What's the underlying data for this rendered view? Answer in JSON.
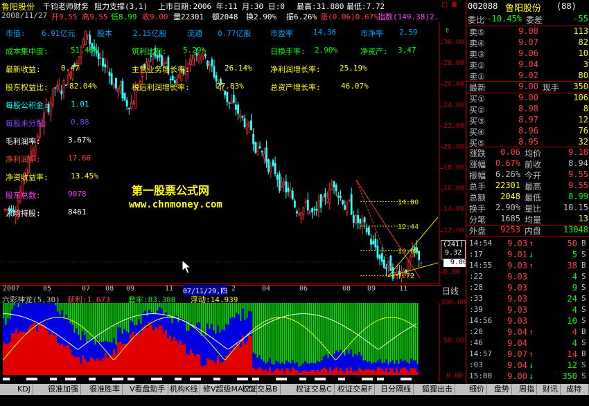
{
  "header": {
    "stock_name": "鲁阳股份",
    "indicator_title": "千钧老师财务",
    "indicator2": "阻力支撑(3,1)",
    "listing_label": "上市日期:2006 年:11 月:30 日:0",
    "high_label": "最高:31.880",
    "low_label": "最低:7.72",
    "date": "2008/11/27",
    "open": "开9.55",
    "high": "高9.55",
    "low": "低8.99",
    "close": "收9.00",
    "volume": "量22301",
    "amount": "额2048",
    "turnover": "换2.90%",
    "amplitude": "振6.26%",
    "change": "涨(0.06)0.67%",
    "index": "指数(149.38)2."
  },
  "fundamentals": [
    {
      "label": "市值:",
      "value": "6.91亿元",
      "color": "#00a0ff"
    },
    {
      "label": "股本",
      "value": "2.15亿股",
      "color": "#00a0ff"
    },
    {
      "label": "流通",
      "value": "0.77亿股",
      "color": "#00a0ff"
    },
    {
      "label": "市盈率",
      "value": "14.36",
      "color": "#00a0ff"
    },
    {
      "label": "市净率",
      "value": "2.59",
      "color": "#00a0ff"
    },
    {
      "label": "成本集中度:",
      "value": "51.48%",
      "color": "#00ff00"
    },
    {
      "label": "筑利比例:",
      "value": "5.29%",
      "color": "#00ff00"
    },
    {
      "label": "日换手率:",
      "value": "2.90%",
      "color": "#00ff00"
    },
    {
      "label": "净资产:",
      "value": "3.47",
      "color": "#00ff00"
    },
    {
      "label": "最新收益:",
      "value": "0.47",
      "color": "#ffff00"
    },
    {
      "label": "主营业务增长率:",
      "value": "26.14%",
      "color": "#ffff00"
    },
    {
      "label": "净利润增长率:",
      "value": "25.19%",
      "color": "#ffff00"
    },
    {
      "label": "股东权益比:",
      "value": "82.04%",
      "color": "#ffff00"
    },
    {
      "label": "税后利润增长率:",
      "value": "27.83%",
      "color": "#ffff00"
    },
    {
      "label": "总资产增长率:",
      "value": "46.07%",
      "color": "#ffff00"
    },
    {
      "label": "每股公积金:",
      "value": "1.01",
      "color": "#00ffff"
    },
    {
      "label": "每股未分配:",
      "value": "0.88",
      "color": "#8040ff"
    },
    {
      "label": "毛利润率:",
      "value": "3.67%",
      "color": "#ffffff"
    },
    {
      "label": "净利润率:",
      "value": "17.66",
      "color": "#ff4040"
    },
    {
      "label": "净资收益率:",
      "value": "13.45%",
      "color": "#ffff00"
    },
    {
      "label": "股东总数:",
      "value": "9078",
      "color": "#ff40ff"
    },
    {
      "label": "人均持股:",
      "value": "8461",
      "color": "#ffffff"
    }
  ],
  "watermark": {
    "line1": "第一股票公式网",
    "line2": "www.chnmoney.com"
  },
  "price_axis": [
    "30.00",
    "28.00",
    "26.00",
    "24.00",
    "22.00",
    "20.00",
    "18.00",
    "16.00",
    "14.00",
    "12.00",
    "10.00",
    "8.00"
  ],
  "levels": [
    "14.80",
    "12.44",
    "10.08",
    "7.72"
  ],
  "cursor_price": "9.00",
  "cursor_box": {
    "line1": "(241)",
    "line2": "9.32"
  },
  "time_axis": [
    "2007",
    "05",
    "07",
    "08",
    "09",
    "11",
    "07/11/29,四",
    "2",
    "04",
    "06",
    "08",
    "09",
    "11"
  ],
  "period_label": "日线",
  "sub_indicator": {
    "name": "六彩神龙(5,30)",
    "v1": "获利:1.673",
    "v2": "套牢:83.388",
    "v3": "浮动:14.939",
    "axis": [
      "100.00",
      "50.00",
      "0.00"
    ]
  },
  "quote": {
    "code": "002088",
    "name": "鲁阳股份",
    "suffix": "(88)",
    "wei_bi_label": "委比",
    "wei_bi": "-10.45%",
    "wei_cha_label": "委差",
    "wei_cha": "-55",
    "sells": [
      {
        "label": "卖⑤",
        "price": "9.08",
        "vol": "113"
      },
      {
        "label": "卖④",
        "price": "9.07",
        "vol": "82"
      },
      {
        "label": "卖③",
        "price": "9.06",
        "vol": "10"
      },
      {
        "label": "卖②",
        "price": "9.04",
        "vol": "3"
      },
      {
        "label": "卖①",
        "price": "9.02",
        "vol": "80"
      }
    ],
    "latest_label": "最新",
    "latest": "9.00",
    "cur_hand_label": "现手",
    "cur_hand": "350",
    "buys": [
      {
        "label": "买①",
        "price": "9.00",
        "vol": "106"
      },
      {
        "label": "买②",
        "price": "8.98",
        "vol": "8"
      },
      {
        "label": "买③",
        "price": "8.97",
        "vol": "12"
      },
      {
        "label": "买④",
        "price": "8.96",
        "vol": "76"
      },
      {
        "label": "买⑤",
        "price": "8.95",
        "vol": "32"
      }
    ],
    "stats": [
      {
        "l1": "涨跌",
        "v1": "0.06",
        "l2": "均价",
        "v2": "9.18"
      },
      {
        "l1": "涨幅",
        "v1": "0.67%",
        "l2": "前收",
        "v2": "8.94"
      },
      {
        "l1": "振幅",
        "v1": "6.26%",
        "l2": "今开",
        "v2": "9.55"
      },
      {
        "l1": "总手",
        "v1": "22301",
        "l2": "最高",
        "v2": "9.55"
      },
      {
        "l1": "总额",
        "v1": "2048",
        "l2": "最低",
        "v2": "8.99"
      },
      {
        "l1": "换手",
        "v1": "2.90%",
        "l2": "量比",
        "v2": "10.15"
      },
      {
        "l1": "分笔",
        "v1": "1685",
        "l2": "均量",
        "v2": "13"
      }
    ],
    "outer_label": "外盘",
    "outer": "9253",
    "inner_label": "内盘",
    "inner": "13048",
    "ticks": [
      {
        "t": "14:54",
        "p": "9.03",
        "a": "↑",
        "v": "50",
        "s": "B"
      },
      {
        "t": ":17",
        "p": "9.01",
        "a": "↓",
        "v": "5",
        "s": "S"
      },
      {
        "t": "14:55",
        "p": "9.03",
        "a": "↑",
        "v": "38",
        "s": "B"
      },
      {
        "t": ":22",
        "p": "9.03",
        "a": "",
        "v": "4",
        "s": "S"
      },
      {
        "t": ":28",
        "p": "9.03",
        "a": "",
        "v": "9",
        "s": "S"
      },
      {
        "t": ":33",
        "p": "9.03",
        "a": "",
        "v": "24",
        "s": "S"
      },
      {
        "t": ":39",
        "p": "9.03",
        "a": "",
        "v": "4",
        "s": "S"
      },
      {
        "t": "14:56",
        "p": "9.03",
        "a": "",
        "v": "10",
        "s": "S"
      },
      {
        "t": ":20",
        "p": "9.04",
        "a": "↑",
        "v": "4",
        "s": "B"
      },
      {
        "t": ":46",
        "p": "9.04",
        "a": "",
        "v": "4",
        "s": "S"
      },
      {
        "t": "14:57",
        "p": "9.07",
        "a": "↑",
        "v": "14",
        "s": "B"
      },
      {
        "t": ":03",
        "p": "9.04",
        "a": "↓",
        "v": "12",
        "s": "S"
      },
      {
        "t": "15:00",
        "p": "9.00",
        "a": "↓",
        "v": "350",
        "s": "S"
      }
    ]
  },
  "tabs": [
    "KDJ",
    "很准加强",
    "很准胜率",
    "V看盘助手",
    "机构K线",
    "修V超级MACD",
    "权证交易B",
    "权证交易C",
    "权证交易F",
    "日分隔线",
    "狐狸出击"
  ],
  "right_tabs": [
    "细价",
    "盘势",
    "周指",
    "财讯",
    "成特解"
  ],
  "window_btns": [
    "□",
    "▣"
  ],
  "chart_data": {
    "type": "candlestick",
    "title": "鲁阳股份",
    "ylim": [
      7.72,
      31.88
    ],
    "y_ticks": [
      8,
      10,
      12,
      14,
      16,
      18,
      20,
      22,
      24,
      26,
      28,
      30
    ],
    "levels": [
      14.8,
      12.44,
      10.08,
      7.72
    ],
    "close_approx": [
      14,
      15,
      17,
      19,
      21,
      23,
      24,
      26,
      25,
      27,
      29,
      30,
      31,
      29,
      27,
      28,
      26,
      25,
      24,
      25,
      27,
      28,
      29,
      28,
      27,
      26,
      27,
      28,
      29,
      30,
      29,
      27,
      26,
      25,
      24,
      23,
      22,
      21,
      20,
      19,
      18,
      17,
      16,
      15,
      14,
      15,
      14,
      13,
      15,
      16,
      17,
      15,
      14,
      13,
      12,
      11,
      10,
      9,
      8.5,
      8,
      8.5,
      9,
      9.5,
      9
    ]
  }
}
